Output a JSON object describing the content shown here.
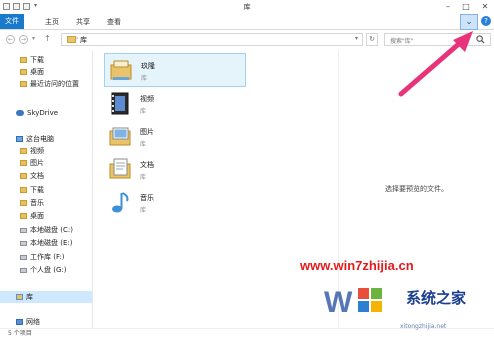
{
  "window": {
    "title": "库"
  },
  "ribbon": {
    "tabs": [
      "文件",
      "主页",
      "共享",
      "查看"
    ]
  },
  "navigation": {
    "address": "库",
    "search_placeholder": "搜索\"库\""
  },
  "sidebar": {
    "favorites": [
      "下载",
      "桌面",
      "最近访问的位置"
    ],
    "cloud": "SkyDrive",
    "pc": {
      "label": "这台电脑",
      "items": [
        "视频",
        "图片",
        "文档",
        "下载",
        "音乐",
        "桌面",
        "本地磁盘 (C:)",
        "本地磁盘 (E:)",
        "工作库 (F:)",
        "个人盘 (G:)"
      ]
    },
    "library": "库",
    "network": "网络"
  },
  "libraries": [
    {
      "name": "玖隆",
      "sub": "库",
      "icon": "library-folder-icon"
    },
    {
      "name": "视频",
      "sub": "库",
      "icon": "video-library-icon"
    },
    {
      "name": "图片",
      "sub": "库",
      "icon": "picture-library-icon"
    },
    {
      "name": "文档",
      "sub": "库",
      "icon": "document-library-icon"
    },
    {
      "name": "音乐",
      "sub": "库",
      "icon": "music-library-icon"
    }
  ],
  "preview_text": "选择要预览的文件。",
  "status": {
    "count": "5 个项目"
  },
  "watermark": {
    "url": "www.win7zhijia.cn",
    "brand": "系统之家",
    "sub": "xitongzhijia.net"
  },
  "colors": {
    "file_tab": "#1979ca",
    "arrow": "#e8337a",
    "selection": "#cde8ff"
  }
}
